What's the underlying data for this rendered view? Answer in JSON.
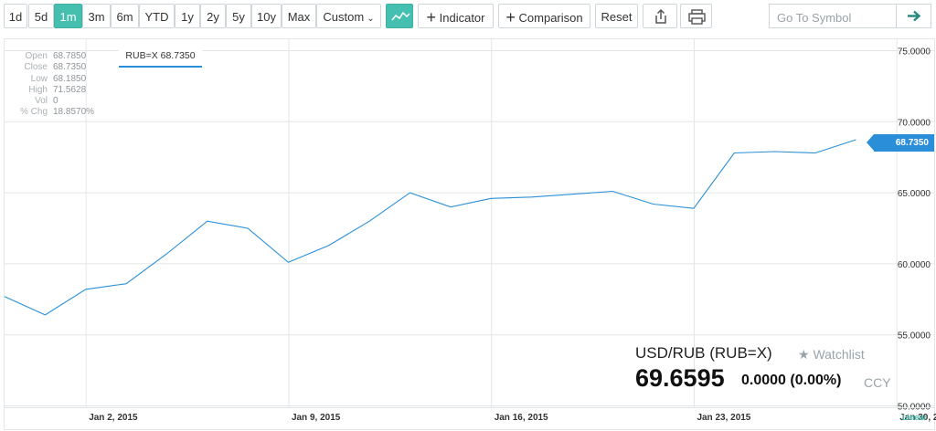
{
  "toolbar": {
    "ranges": [
      "1d",
      "5d",
      "1m",
      "3m",
      "6m",
      "YTD",
      "1y",
      "2y",
      "5y",
      "10y",
      "Max"
    ],
    "active_range": "1m",
    "custom_label": "Custom",
    "indicator_label": "Indicator",
    "comparison_label": "Comparison",
    "reset_label": "Reset",
    "symbol_placeholder": "Go To Symbol"
  },
  "ohlc": {
    "rows": [
      {
        "key": "Open",
        "value": "68.7850"
      },
      {
        "key": "Close",
        "value": "68.7350"
      },
      {
        "key": "Low",
        "value": "68.1850"
      },
      {
        "key": "High",
        "value": "71.5628"
      },
      {
        "key": "Vol",
        "value": "0"
      },
      {
        "key": "% Chg",
        "value": "18.8570%"
      }
    ]
  },
  "legend_label": "RUB=X 68.7350",
  "last_price_tag": "68.7350",
  "quote": {
    "title": "USD/RUB (RUB=X)",
    "watchlist_label": "Watchlist",
    "price": "69.6595",
    "change": "0.0000",
    "change_pct": "(0.00%)",
    "currency": "CCY"
  },
  "scale_label": "Linear",
  "colors": {
    "accent": "#45c0b0",
    "line": "#2a8fd8",
    "grid": "#e3e6e8"
  },
  "chart_data": {
    "type": "line",
    "series": [
      {
        "name": "RUB=X",
        "x": [
          "2014-12-30",
          "2014-12-31",
          "2015-01-02",
          "2015-01-05",
          "2015-01-06",
          "2015-01-07",
          "2015-01-08",
          "2015-01-09",
          "2015-01-12",
          "2015-01-13",
          "2015-01-14",
          "2015-01-15",
          "2015-01-16",
          "2015-01-19",
          "2015-01-20",
          "2015-01-21",
          "2015-01-22",
          "2015-01-23",
          "2015-01-26",
          "2015-01-27",
          "2015-01-28",
          "2015-01-29"
        ],
        "values": [
          57.7,
          56.4,
          58.2,
          58.6,
          60.7,
          63.0,
          62.5,
          60.1,
          61.3,
          63.0,
          65.0,
          64.0,
          64.6,
          64.7,
          64.9,
          65.1,
          64.2,
          63.9,
          67.8,
          67.9,
          67.8,
          68.735
        ]
      }
    ],
    "ylim": [
      50,
      75
    ],
    "yticks": [
      "75.0000",
      "70.0000",
      "65.0000",
      "60.0000",
      "55.0000",
      "50.0000"
    ],
    "ytick_values": [
      75,
      70,
      65,
      60,
      55,
      50
    ],
    "xticks": [
      "Jan 2, 2015",
      "Jan 9, 2015",
      "Jan 16, 2015",
      "Jan 23, 2015",
      "Jan 30, 2"
    ],
    "xtick_indices": [
      2,
      7,
      12,
      17,
      22
    ],
    "grid": true,
    "scale": "linear"
  }
}
